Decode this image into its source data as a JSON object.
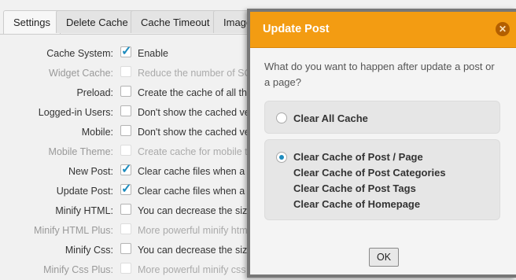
{
  "tabs": [
    "Settings",
    "Delete Cache",
    "Cache Timeout",
    "Image"
  ],
  "rows": [
    {
      "label": "Cache System:",
      "desc": "Enable",
      "checked": true,
      "disabled": false
    },
    {
      "label": "Widget Cache:",
      "desc": "Reduce the number of SQL",
      "checked": false,
      "disabled": true
    },
    {
      "label": "Preload:",
      "desc": "Create the cache of all the s",
      "checked": false,
      "disabled": false
    },
    {
      "label": "Logged-in Users:",
      "desc": "Don't show the cached vers",
      "checked": false,
      "disabled": false
    },
    {
      "label": "Mobile:",
      "desc": "Don't show the cached vers",
      "checked": false,
      "disabled": false
    },
    {
      "label": "Mobile Theme:",
      "desc": "Create cache for mobile the",
      "checked": false,
      "disabled": true
    },
    {
      "label": "New Post:",
      "desc": "Clear cache files when a po",
      "checked": true,
      "disabled": false
    },
    {
      "label": "Update Post:",
      "desc": "Clear cache files when a po",
      "checked": true,
      "disabled": false
    },
    {
      "label": "Minify HTML:",
      "desc": "You can decrease the size o",
      "checked": false,
      "disabled": false
    },
    {
      "label": "Minify HTML Plus:",
      "desc": "More powerful minify html",
      "checked": false,
      "disabled": true
    },
    {
      "label": "Minify Css:",
      "desc": "You can decrease the size o",
      "checked": false,
      "disabled": false
    },
    {
      "label": "Minify Css Plus:",
      "desc": "More powerful minify css",
      "checked": false,
      "disabled": true
    }
  ],
  "dialog": {
    "title": "Update Post",
    "close_icon": "close-icon",
    "question": "What do you want to happen after update a post or a page?",
    "option1": "Clear All Cache",
    "option2_lines": [
      "Clear Cache of Post / Page",
      "Clear Cache of Post Categories",
      "Clear Cache of Post Tags",
      "Clear Cache of Homepage"
    ],
    "selected_option": 2,
    "ok_label": "OK",
    "header_color": "#f39c12"
  }
}
